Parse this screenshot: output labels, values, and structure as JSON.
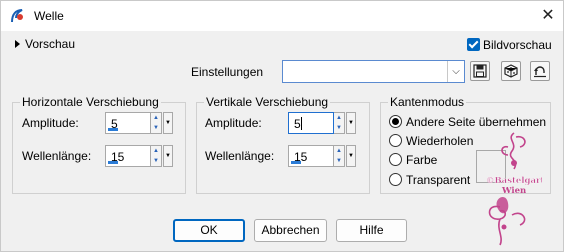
{
  "window": {
    "title": "Welle",
    "close_glyph": "✕"
  },
  "preview": {
    "label": "Vorschau"
  },
  "bildvorschau": {
    "label": "Bildvorschau",
    "checked": true
  },
  "settings": {
    "label": "Einstellungen",
    "value": ""
  },
  "horizontal": {
    "title": "Horizontale Verschiebung",
    "amplitude_label": "Amplitude:",
    "amplitude_value": "5",
    "wavelength_label": "Wellenlänge:",
    "wavelength_value": "15"
  },
  "vertical": {
    "title": "Vertikale Verschiebung",
    "amplitude_label": "Amplitude:",
    "amplitude_value": "5",
    "wavelength_label": "Wellenlänge:",
    "wavelength_value": "15"
  },
  "edge_mode": {
    "title": "Kantenmodus",
    "options": [
      "Andere Seite übernehmen",
      "Wiederholen",
      "Farbe",
      "Transparent"
    ],
    "selected_index": 0
  },
  "buttons": {
    "ok": "OK",
    "cancel": "Abbrechen",
    "help": "Hilfe"
  },
  "watermark": {
    "line1": "©Bastelgarten",
    "line2": "Wien"
  },
  "colors": {
    "accent": "#0067c0",
    "watermark": "#c2448c"
  },
  "icons": [
    "app-icon",
    "close-icon",
    "expand-triangle-icon",
    "checkbox-icon",
    "dropdown-arrow-icon",
    "save-preset-icon",
    "random-icon",
    "reset-icon",
    "spin-up-icon",
    "spin-down-icon",
    "watermark-logo"
  ]
}
